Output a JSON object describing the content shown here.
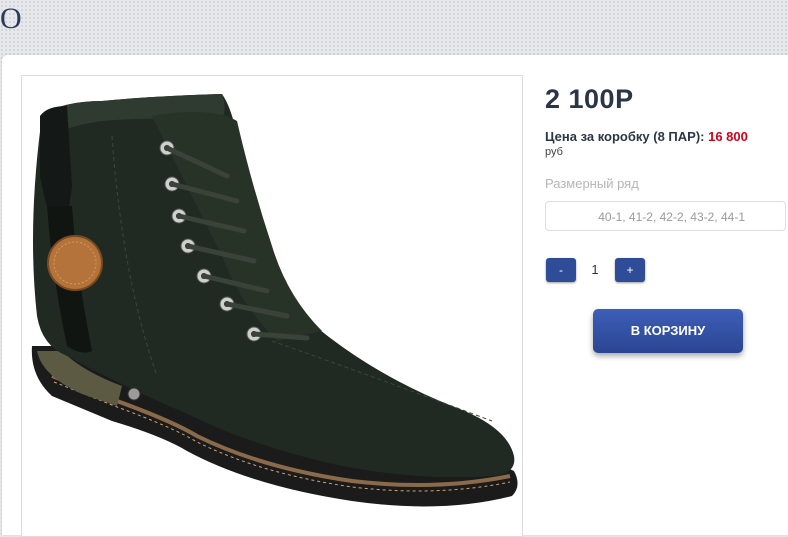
{
  "header": {
    "title_fragment": "О"
  },
  "product": {
    "image_alt": "Черные кожаные ботинки на шнуровке",
    "price": "2 100Р",
    "box_price_label": "Цена за коробку (8 ПАР):",
    "box_price_value": "16 800",
    "currency": "руб",
    "size_label": "Размерный ряд",
    "size_value": "40-1, 41-2, 42-2, 43-2, 44-1",
    "quantity": {
      "minus_label": "-",
      "value": "1",
      "plus_label": "+"
    },
    "cart_button": "В КОРЗИНУ"
  },
  "colors": {
    "button_blue": "#2f4c99",
    "price_red": "#d0021b",
    "text_dark": "#2b3548"
  }
}
